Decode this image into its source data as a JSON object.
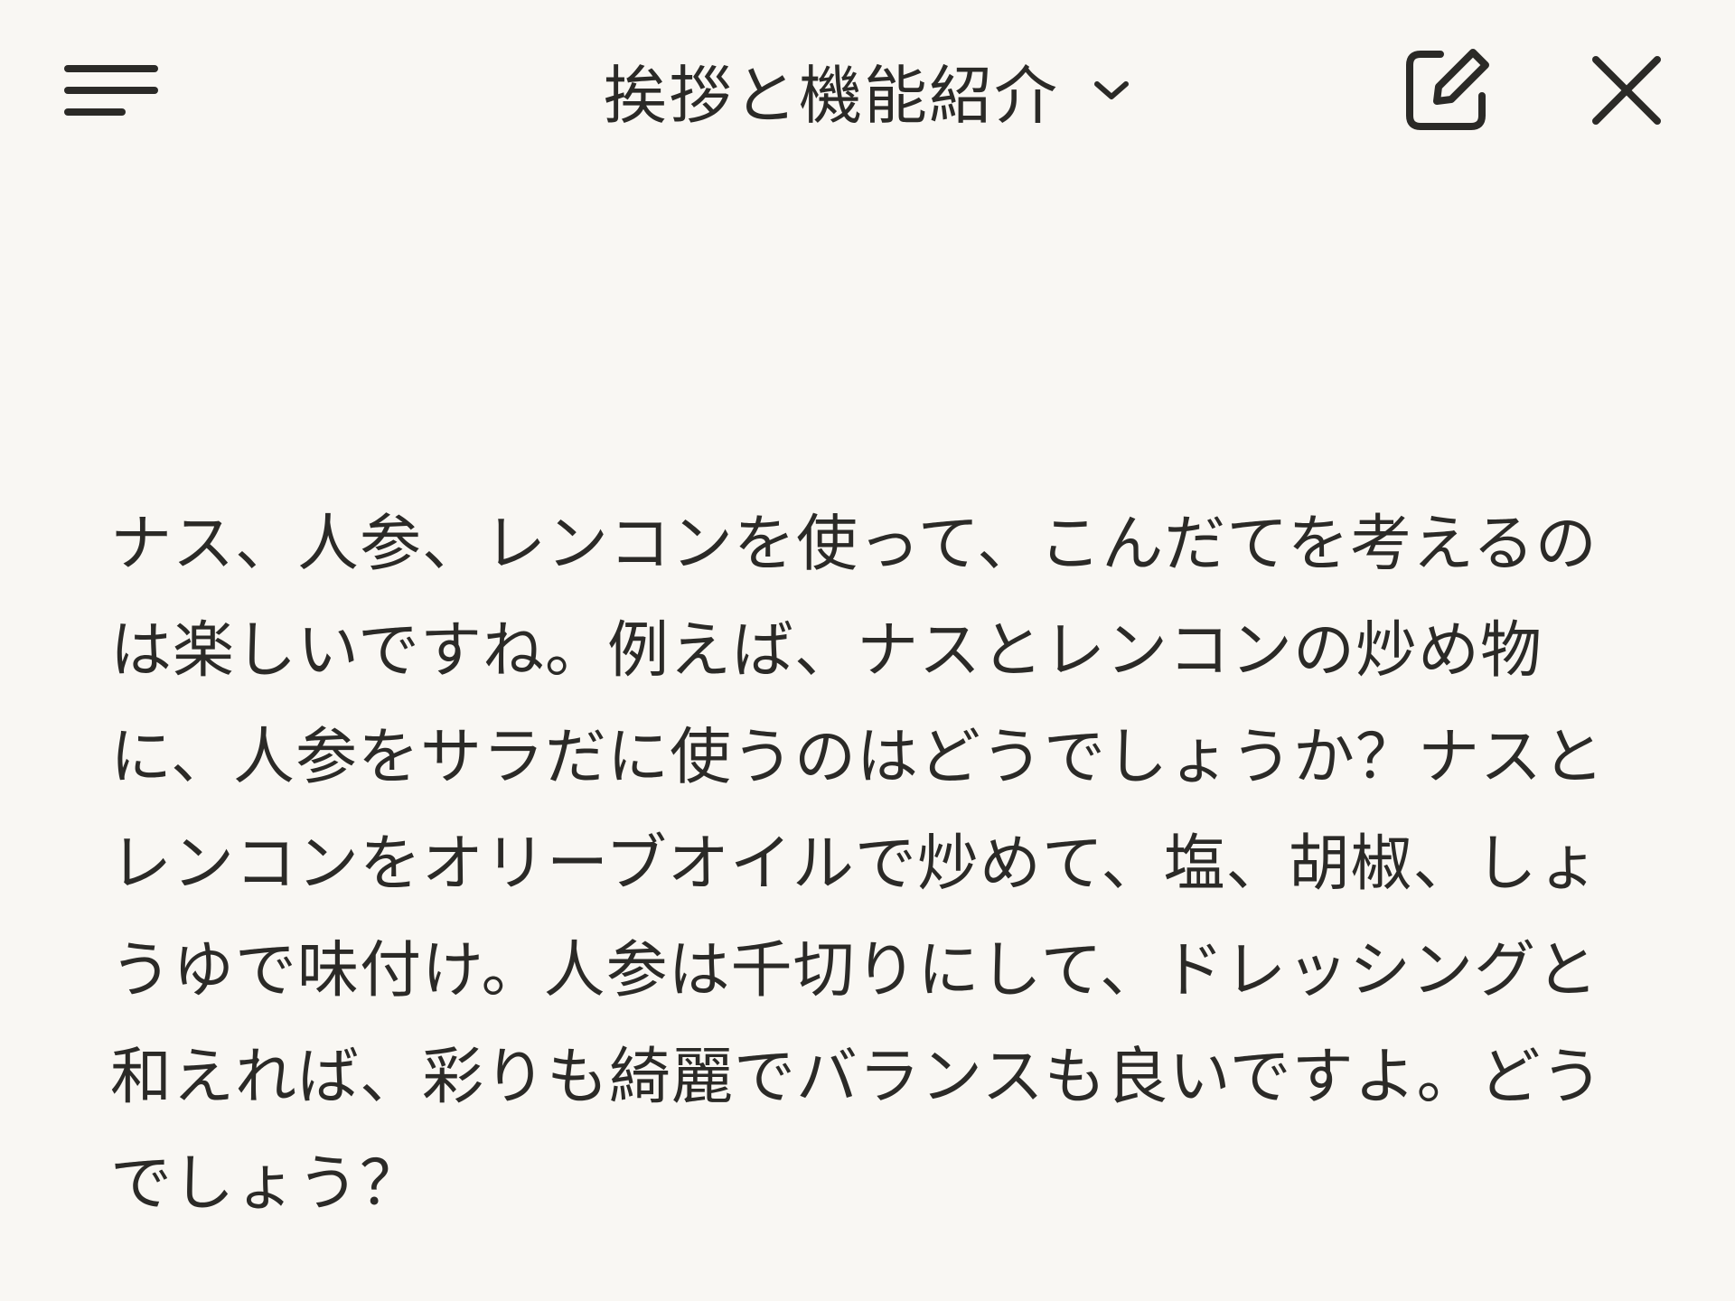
{
  "header": {
    "title": "挨拶と機能紹介",
    "menu_icon": "menu-icon",
    "dropdown_icon": "chevron-down-icon",
    "new_chat_icon": "new-chat-icon",
    "close_icon": "close-icon"
  },
  "conversation": {
    "assistant_message": "ナス、人参、レンコンを使って、こんだてを考えるのは楽しいですね。例えば、ナスとレンコンの炒め物に、人参をサラだに使うのはどうでしょうか？ナスとレンコンをオリーブオイルで炒めて、塩、胡椒、しょうゆで味付け。人参は千切りにして、ドレッシングと和えれば、彩りも綺麗でバランスも良いですよ。どうでしょう？"
  },
  "colors": {
    "background": "#f9f7f3",
    "text": "#2b2a27"
  }
}
